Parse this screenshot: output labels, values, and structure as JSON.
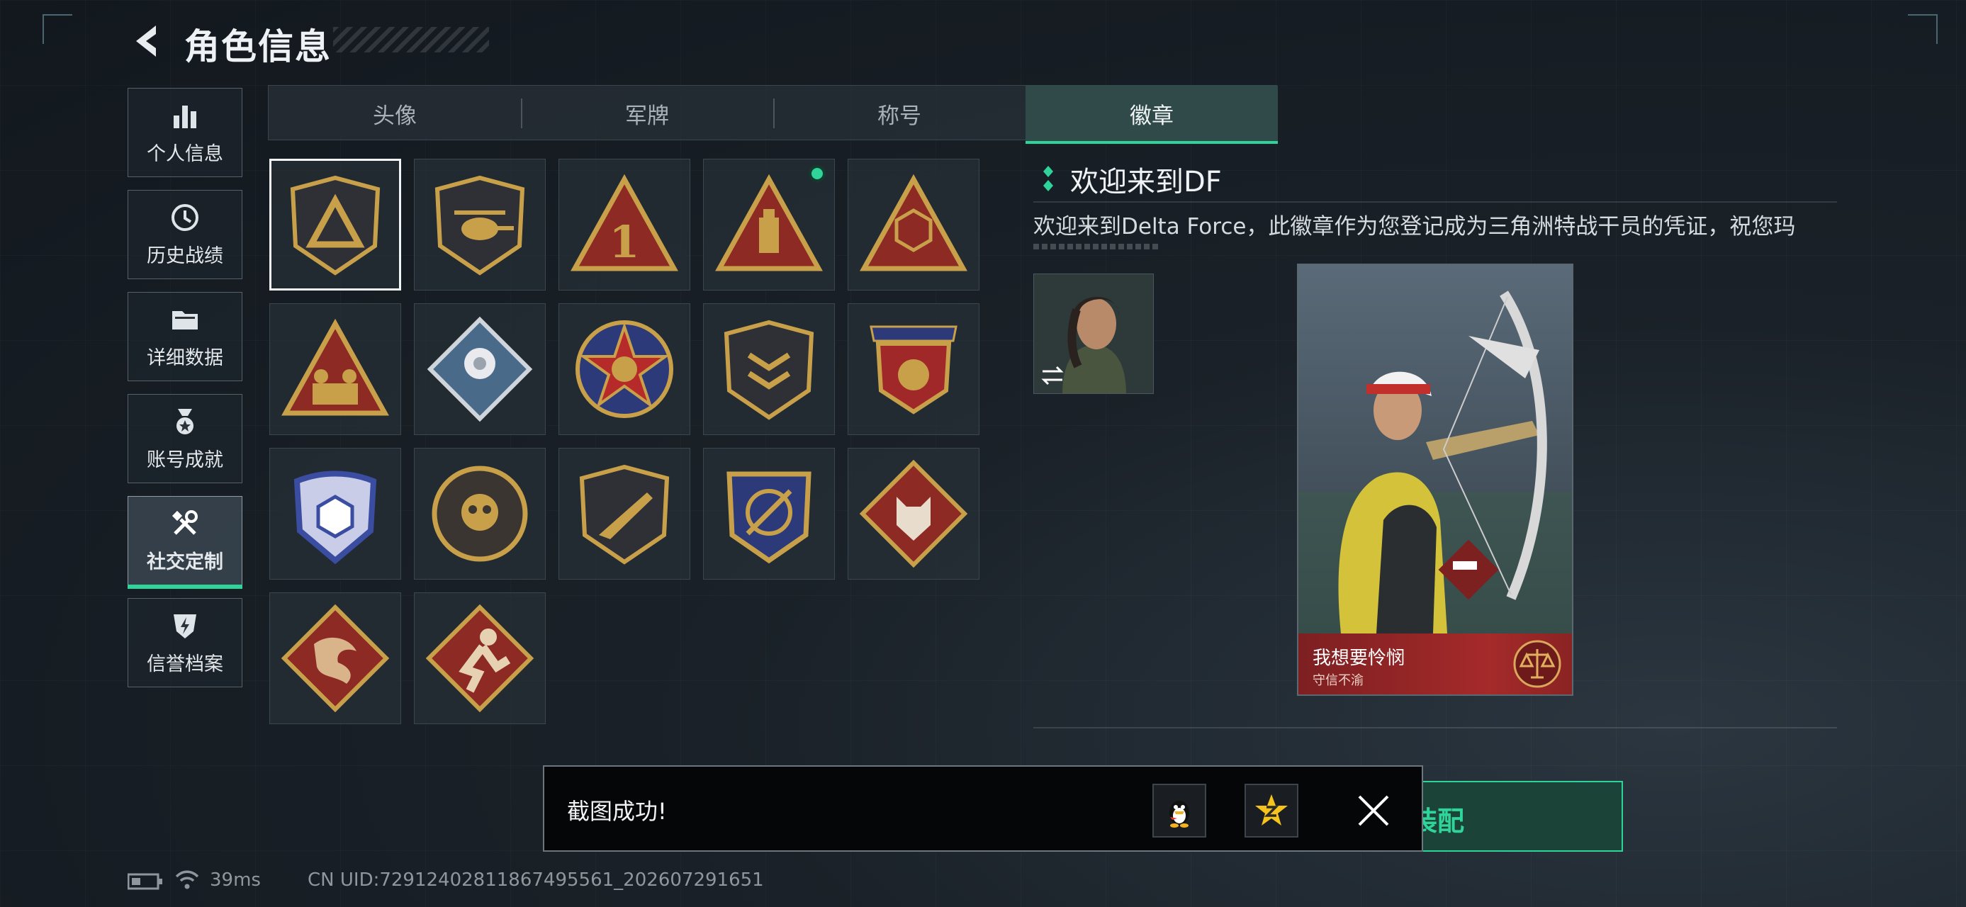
{
  "header": {
    "title": "角色信息"
  },
  "sidebar": {
    "items": [
      {
        "label": "个人信息",
        "icon": "bar-chart-icon"
      },
      {
        "label": "历史战绩",
        "icon": "clock-icon"
      },
      {
        "label": "详细数据",
        "icon": "folder-icon"
      },
      {
        "label": "账号成就",
        "icon": "medal-icon"
      },
      {
        "label": "社交定制",
        "icon": "tools-icon",
        "active": true
      },
      {
        "label": "信誉档案",
        "icon": "shield-lightning-icon"
      }
    ]
  },
  "tabs": [
    {
      "label": "头像"
    },
    {
      "label": "军牌"
    },
    {
      "label": "称号"
    },
    {
      "label": "徽章",
      "active": true
    }
  ],
  "badges": [
    {
      "name": "delta-shield-badge",
      "selected": true
    },
    {
      "name": "helicopter-badge"
    },
    {
      "name": "number-one-badge"
    },
    {
      "name": "usb-drive-badge",
      "new": true
    },
    {
      "name": "cube-hands-badge"
    },
    {
      "name": "squad-badge"
    },
    {
      "name": "flower-badge"
    },
    {
      "name": "skull-star-badge"
    },
    {
      "name": "chevron-shield-badge"
    },
    {
      "name": "laurel-shield-badge"
    },
    {
      "name": "blue-crest-badge"
    },
    {
      "name": "round-skull-badge"
    },
    {
      "name": "rifle-badge"
    },
    {
      "name": "target-crest-badge"
    },
    {
      "name": "wolf-badge"
    },
    {
      "name": "dragon-badge"
    },
    {
      "name": "runner-badge"
    }
  ],
  "detail": {
    "title": "欢迎来到DF",
    "description": "欢迎来到Delta Force，此徽章作为您登记成为三角洲特战干员的凭证，祝您玛"
  },
  "card": {
    "name": "我想要怜悯",
    "subtitle": "守信不渝"
  },
  "equip_button": {
    "label": "装配"
  },
  "toast": {
    "message": "截图成功!"
  },
  "status": {
    "ping": "39ms",
    "uid": "CN UID:72912402811867495561_202607291651"
  },
  "colors": {
    "accent": "#2fd49a",
    "badge_gold": "#c9a04a",
    "badge_red": "#8e2a24"
  }
}
